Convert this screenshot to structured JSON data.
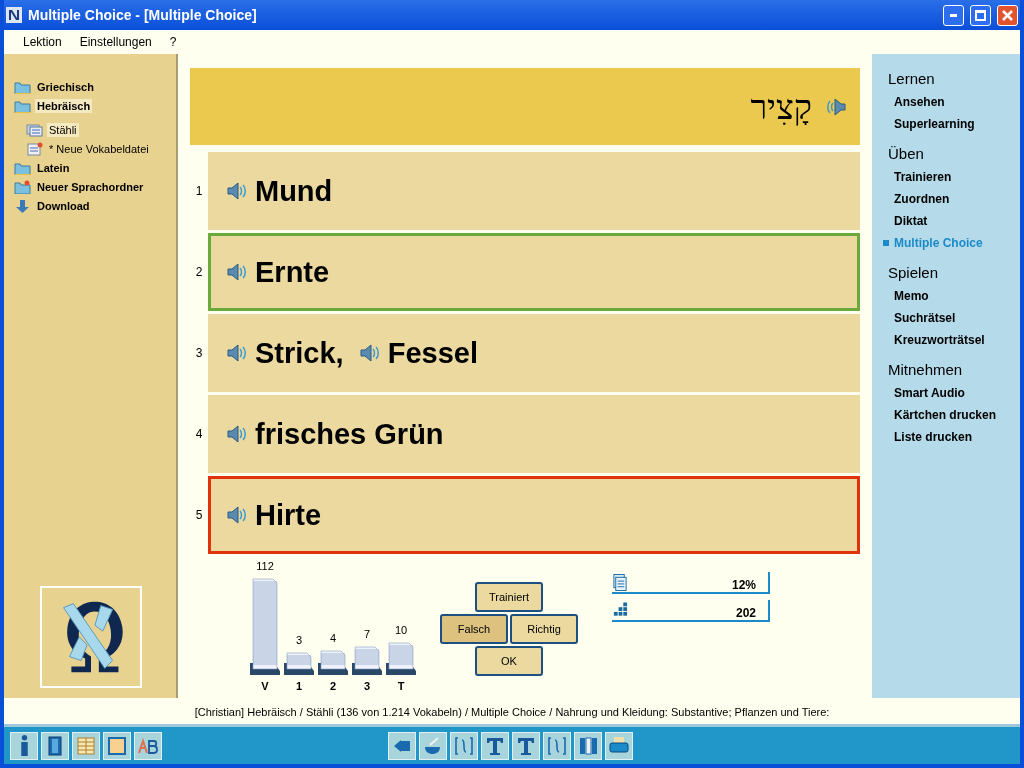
{
  "window": {
    "title": "Multiple Choice - [Multiple Choice]"
  },
  "menu": [
    "Lektion",
    "Einstellungen",
    "?"
  ],
  "sidebar": {
    "items": [
      {
        "label": "Griechisch",
        "kind": "folder",
        "selected": false
      },
      {
        "label": "Hebräisch",
        "kind": "folder",
        "selected": true,
        "children": [
          {
            "label": "Stähli",
            "kind": "file",
            "selected": true
          },
          {
            "label": "* Neue Vokabeldatei",
            "kind": "new-file",
            "selected": false
          }
        ]
      },
      {
        "label": "Latein",
        "kind": "folder",
        "selected": false
      },
      {
        "label": "Neuer Sprachordner",
        "kind": "new-folder",
        "selected": false
      },
      {
        "label": "Download",
        "kind": "download",
        "selected": false
      }
    ]
  },
  "question": {
    "word": "קָצִיר"
  },
  "answers": [
    {
      "number": "1",
      "words": [
        "Mund"
      ],
      "selected": false,
      "correct": false
    },
    {
      "number": "2",
      "words": [
        "Ernte"
      ],
      "selected": false,
      "correct": true
    },
    {
      "number": "3",
      "words": [
        "Strick,",
        "Fessel"
      ],
      "selected": false,
      "correct": false
    },
    {
      "number": "4",
      "words": [
        "frisches Grün"
      ],
      "selected": false,
      "correct": false
    },
    {
      "number": "5",
      "words": [
        "Hirte"
      ],
      "selected": true,
      "correct": false
    }
  ],
  "card_boxes": [
    {
      "count": "112",
      "label": "V"
    },
    {
      "count": "3",
      "label": "1"
    },
    {
      "count": "4",
      "label": "2"
    },
    {
      "count": "7",
      "label": "3"
    },
    {
      "count": "10",
      "label": "T"
    }
  ],
  "buttons": [
    {
      "label": "Trainiert",
      "pressed": false
    },
    {
      "label": "Falsch",
      "pressed": true
    },
    {
      "label": "Richtig",
      "pressed": false
    },
    {
      "label": "OK",
      "pressed": false
    }
  ],
  "stats": [
    {
      "kind": "progress",
      "value": "12%"
    },
    {
      "kind": "count",
      "value": "202"
    }
  ],
  "nav": [
    {
      "title": "Lernen",
      "items": [
        {
          "label": "Ansehen",
          "selected": false
        },
        {
          "label": "Superlearning",
          "selected": false
        }
      ]
    },
    {
      "title": "Üben",
      "items": [
        {
          "label": "Trainieren",
          "selected": false
        },
        {
          "label": "Zuordnen",
          "selected": false
        },
        {
          "label": "Diktat",
          "selected": false
        },
        {
          "label": "Multiple Choice",
          "selected": true
        }
      ]
    },
    {
      "title": "Spielen",
      "items": [
        {
          "label": "Memo",
          "selected": false
        },
        {
          "label": "Suchrätsel",
          "selected": false
        },
        {
          "label": "Kreuzworträtsel",
          "selected": false
        }
      ]
    },
    {
      "title": "Mitnehmen",
      "items": [
        {
          "label": "Smart Audio",
          "selected": false
        },
        {
          "label": "Kärtchen drucken",
          "selected": false
        },
        {
          "label": "Liste drucken",
          "selected": false
        }
      ]
    }
  ],
  "status_bar": "[Christian]  Hebräisch / Stähli  (136 von 1.214 Vokabeln) / Multiple Choice / Nahrung und Kleidung: Substantive; Pflanzen und Tiere:"
}
